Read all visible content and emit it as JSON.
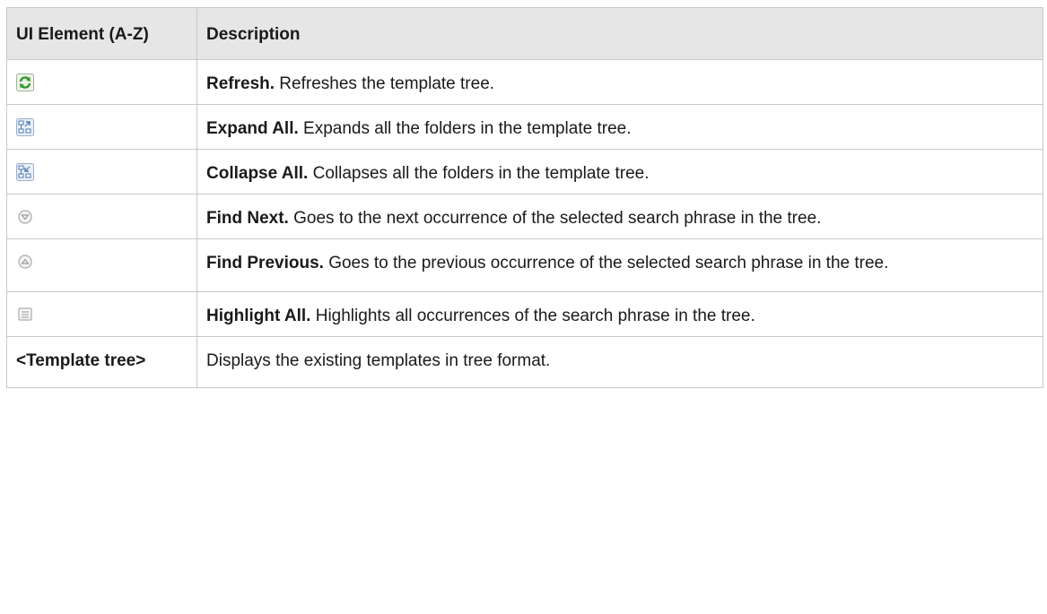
{
  "table": {
    "headers": {
      "element": "UI Element (A-Z)",
      "description": "Description"
    },
    "rows": [
      {
        "icon": "refresh-icon",
        "term": "Refresh.",
        "text": " Refreshes the template tree."
      },
      {
        "icon": "expand-all-icon",
        "term": "Expand All.",
        "text": " Expands all the folders in the template tree."
      },
      {
        "icon": "collapse-all-icon",
        "term": "Collapse All.",
        "text": " Collapses all the folders in the template tree."
      },
      {
        "icon": "find-next-icon",
        "term": "Find Next.",
        "text": " Goes to the next occurrence of the selected search phrase in the tree."
      },
      {
        "icon": "find-previous-icon",
        "term": "Find Previous.",
        "text": " Goes to the previous occurrence of the selected search phrase in the tree."
      },
      {
        "icon": "highlight-all-icon",
        "term": "Highlight All.",
        "text": " Highlights all occurrences of the search phrase in the tree."
      },
      {
        "element_text": "<Template tree>",
        "text": "Displays the existing templates in tree format."
      }
    ]
  },
  "colors": {
    "header_background": "#e6e6e6",
    "border": "#c8c8c8",
    "refresh_green": "#2f9a2a",
    "icon_blue": "#4a78b5"
  }
}
